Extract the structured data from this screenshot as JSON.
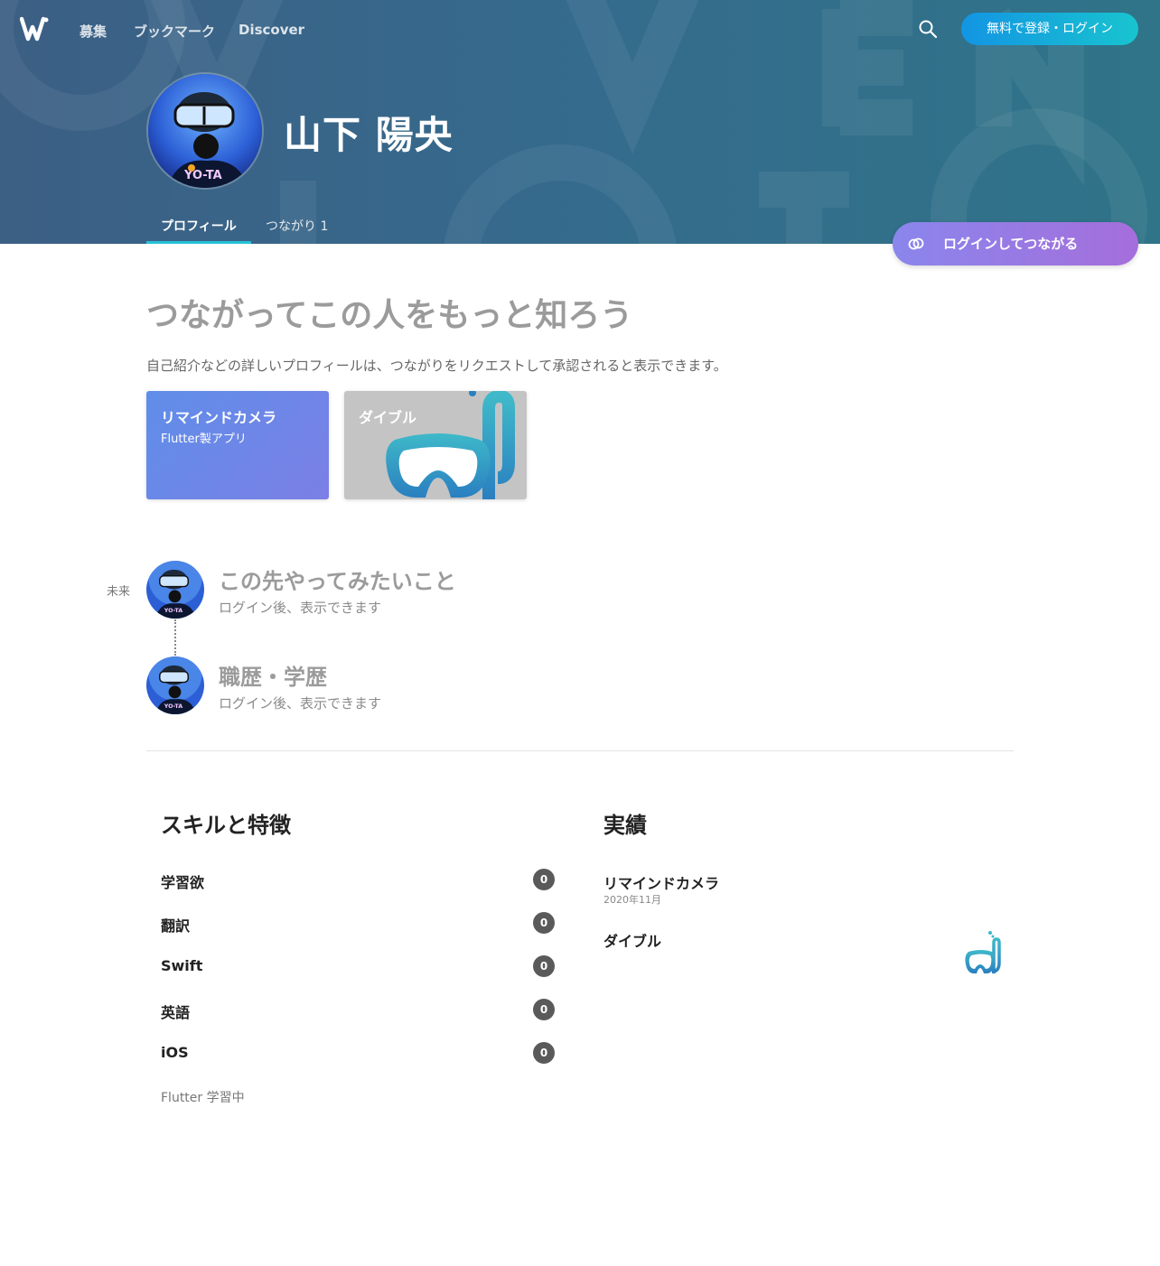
{
  "nav": {
    "items": [
      "募集",
      "ブックマーク",
      "Discover"
    ],
    "signup_label": "無料で登録・ログイン"
  },
  "profile": {
    "name": "山下 陽央",
    "tabs": {
      "profile": "プロフィール",
      "connections": "つながり 1"
    }
  },
  "connect_button": "ログインしてつながる",
  "lead": {
    "title": "つながってこの人をもっと知ろう",
    "description": "自己紹介などの詳しいプロフィールは、つながりをリクエストして承認されると表示できます。"
  },
  "cards": [
    {
      "title": "リマインドカメラ",
      "subtitle": "Flutter製アプリ"
    },
    {
      "title": "ダイブル"
    }
  ],
  "timeline": {
    "label": "未来",
    "items": [
      {
        "title": "この先やってみたいこと",
        "subtitle": "ログイン後、表示できます"
      },
      {
        "title": "職歴・学歴",
        "subtitle": "ログイン後、表示できます"
      }
    ]
  },
  "skills": {
    "title": "スキルと特徴",
    "items": [
      {
        "name": "学習欲",
        "count": "0"
      },
      {
        "name": "翻訳",
        "count": "0"
      },
      {
        "name": "Swift",
        "count": "0"
      },
      {
        "name": "英語",
        "count": "0"
      },
      {
        "name": "iOS",
        "count": "0"
      }
    ],
    "note": "Flutter 学習中"
  },
  "achievements": {
    "title": "実績",
    "items": [
      {
        "name": "リマインドカメラ",
        "date": "2020年11月"
      },
      {
        "name": "ダイブル"
      }
    ]
  },
  "colors": {
    "hero": "#356b8d",
    "signup": "#1395e3",
    "connect": "#9a7ae2",
    "tab_underline": "#27c1d8",
    "badge": "#5a5a5a"
  },
  "icons": [
    "wantedly-logo-icon",
    "search-icon",
    "link-icon",
    "snorkel-mask-icon"
  ]
}
